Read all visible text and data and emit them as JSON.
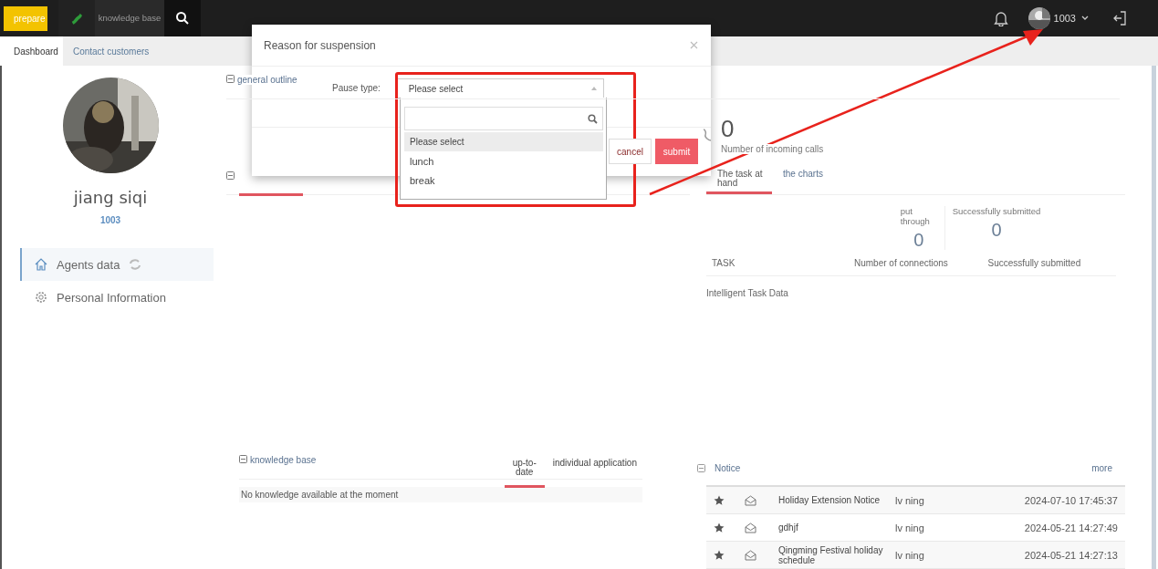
{
  "topbar": {
    "status": {
      "label": "prepare"
    },
    "knowledge": "knowledge base",
    "user": "1003"
  },
  "tabs": [
    {
      "label": "Dashboard",
      "selected": true
    },
    {
      "label": "Contact customers",
      "selected": false
    }
  ],
  "profile": {
    "name": "jiang siqi",
    "id": "1003"
  },
  "menu": [
    {
      "label": "Agents data",
      "selected": true
    },
    {
      "label": "Personal Information",
      "selected": false
    }
  ],
  "outline": {
    "title": "general outline",
    "incoming": {
      "value": "0",
      "label": "Number of incoming calls"
    }
  },
  "task": {
    "tabs": [
      {
        "label": "The task at hand",
        "selected": true
      },
      {
        "label": "the charts",
        "selected": false
      }
    ],
    "stats": [
      {
        "label": "put through",
        "value": "0"
      },
      {
        "label": "Successfully submitted",
        "value": "0"
      }
    ],
    "columns": [
      "TASK",
      "Number of connections",
      "Successfully submitted"
    ],
    "rows": [
      [
        "Intelligent Task Data"
      ]
    ]
  },
  "knowledge": {
    "title": "knowledge base",
    "tabs": [
      {
        "label": "up-to-date",
        "selected": true
      },
      {
        "label": "individual application",
        "selected": false
      }
    ],
    "empty": "No knowledge available at the moment"
  },
  "notice": {
    "title": "Notice",
    "more": "more",
    "rows": [
      {
        "title": "Holiday Extension Notice",
        "author": "lv ning",
        "time": "2024-07-10 17:45:37"
      },
      {
        "title": "gdhjf",
        "author": "lv ning",
        "time": "2024-05-21 14:27:49"
      },
      {
        "title": "Qingming Festival holiday schedule",
        "author": "lv ning",
        "time": "2024-05-21 14:27:13"
      }
    ]
  },
  "modal": {
    "title": "Reason for suspension",
    "field_label": "Pause type:",
    "value": "Please select",
    "options": [
      {
        "label": "Please select",
        "selected": true
      },
      {
        "label": "lunch",
        "selected": false
      },
      {
        "label": "break",
        "selected": false
      }
    ],
    "buttons": [
      {
        "label": "cancel",
        "kind": "secondary"
      },
      {
        "label": "submit",
        "kind": "primary"
      }
    ]
  }
}
